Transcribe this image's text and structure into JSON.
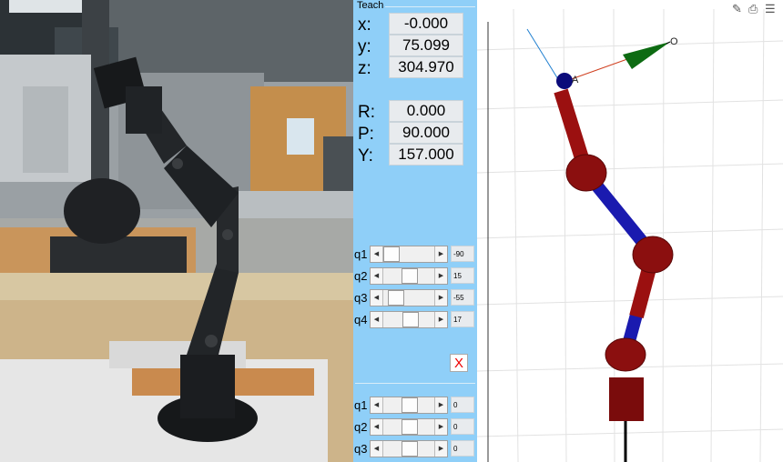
{
  "teach": {
    "title": "Teach",
    "position": [
      {
        "label": "x:",
        "value": "-0.000"
      },
      {
        "label": "y:",
        "value": "75.099"
      },
      {
        "label": "z:",
        "value": "304.970"
      }
    ],
    "orientation": [
      {
        "label": "R:",
        "value": "0.000"
      },
      {
        "label": "P:",
        "value": "90.000"
      },
      {
        "label": "Y:",
        "value": "157.000"
      }
    ],
    "joints": [
      {
        "label": "q1",
        "value": "-90"
      },
      {
        "label": "q2",
        "value": "15"
      },
      {
        "label": "q3",
        "value": "-55"
      },
      {
        "label": "q4",
        "value": "17"
      }
    ],
    "close_label": "X",
    "joints2": [
      {
        "label": "q1",
        "value": "0"
      },
      {
        "label": "q2",
        "value": "0"
      },
      {
        "label": "q3",
        "value": "0"
      }
    ]
  },
  "plot": {
    "point_labels": {
      "approach": "A",
      "orientation": "O"
    },
    "link_colors": {
      "joint": "#8b0f0f",
      "link_red": "#9b1010",
      "link_blue": "#1a1aaf"
    },
    "toolbar_icons": [
      "edit-icon",
      "print-icon",
      "menu-icon"
    ]
  }
}
